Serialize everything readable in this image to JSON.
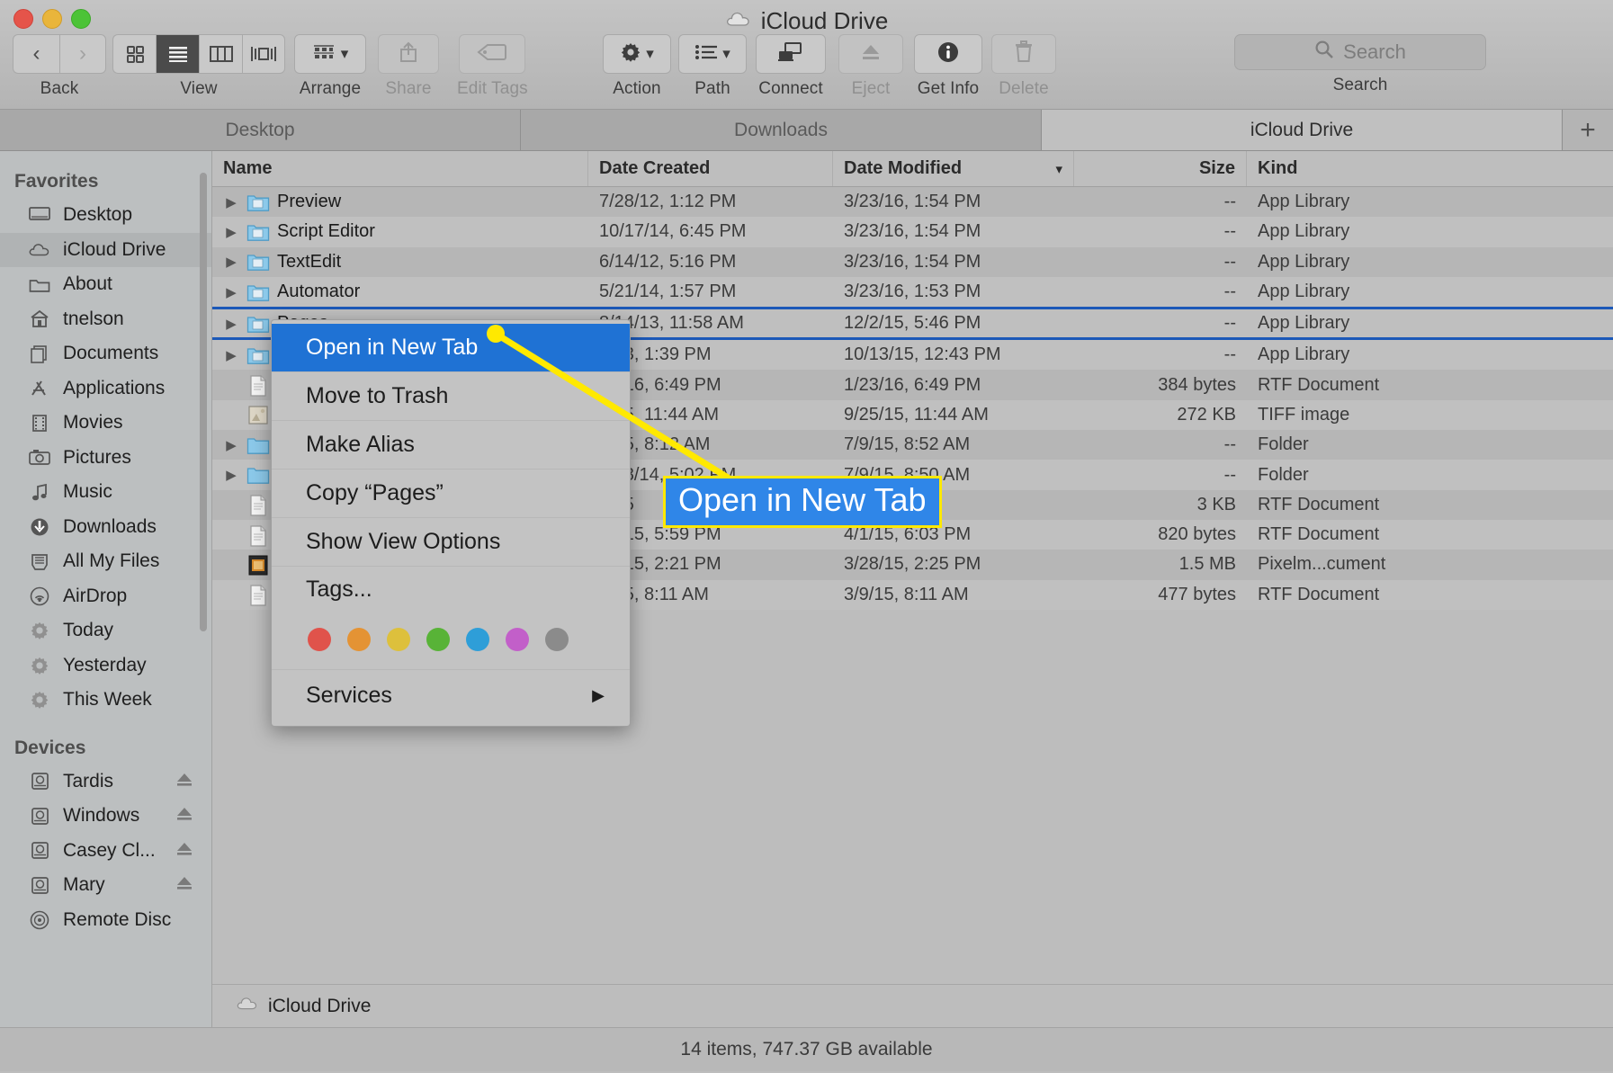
{
  "window": {
    "title": "iCloud Drive",
    "title_icon": "cloud-icon",
    "traffic_lights": [
      "close",
      "minimize",
      "zoom"
    ]
  },
  "toolbar": {
    "back_label": "Back",
    "back_icon": "chevron-left-icon",
    "forward_icon": "chevron-right-icon",
    "view_label": "View",
    "view_modes": [
      "icon-view-icon",
      "list-view-icon",
      "column-view-icon",
      "cover-flow-icon"
    ],
    "view_active_index": 1,
    "arrange_label": "Arrange",
    "arrange_icon": "grid-arrange-icon",
    "share_label": "Share",
    "share_icon": "share-icon",
    "edit_tags_label": "Edit Tags",
    "edit_tags_icon": "tag-icon",
    "action_label": "Action",
    "action_icon": "gear-icon",
    "path_label": "Path",
    "path_icon": "list-path-icon",
    "connect_label": "Connect",
    "connect_icon": "connect-server-icon",
    "eject_label": "Eject",
    "eject_icon": "eject-icon",
    "get_info_label": "Get Info",
    "get_info_icon": "info-icon",
    "delete_label": "Delete",
    "delete_icon": "trash-icon",
    "search_label": "Search",
    "search_placeholder": "Search",
    "search_icon": "search-icon",
    "search_value": ""
  },
  "tabs": {
    "items": [
      {
        "label": "Desktop",
        "active": false
      },
      {
        "label": "Downloads",
        "active": false
      },
      {
        "label": "iCloud Drive",
        "active": true
      }
    ],
    "new_tab_label": "+",
    "new_tab_icon": "plus-icon"
  },
  "sidebar": {
    "sections": [
      {
        "title": "Favorites",
        "items": [
          {
            "label": "Desktop",
            "icon": "desktop-icon",
            "selected": false,
            "eject": false
          },
          {
            "label": "iCloud Drive",
            "icon": "cloud-icon",
            "selected": true,
            "eject": false
          },
          {
            "label": "About",
            "icon": "folder-icon",
            "selected": false,
            "eject": false
          },
          {
            "label": "tnelson",
            "icon": "home-icon",
            "selected": false,
            "eject": false
          },
          {
            "label": "Documents",
            "icon": "documents-icon",
            "selected": false,
            "eject": false
          },
          {
            "label": "Applications",
            "icon": "applications-icon",
            "selected": false,
            "eject": false
          },
          {
            "label": "Movies",
            "icon": "film-icon",
            "selected": false,
            "eject": false
          },
          {
            "label": "Pictures",
            "icon": "camera-icon",
            "selected": false,
            "eject": false
          },
          {
            "label": "Music",
            "icon": "music-note-icon",
            "selected": false,
            "eject": false
          },
          {
            "label": "Downloads",
            "icon": "download-icon",
            "selected": false,
            "eject": false
          },
          {
            "label": "All My Files",
            "icon": "all-my-files-icon",
            "selected": false,
            "eject": false
          },
          {
            "label": "AirDrop",
            "icon": "airdrop-icon",
            "selected": false,
            "eject": false
          },
          {
            "label": "Today",
            "icon": "gear-icon",
            "selected": false,
            "eject": false
          },
          {
            "label": "Yesterday",
            "icon": "gear-icon",
            "selected": false,
            "eject": false
          },
          {
            "label": "This Week",
            "icon": "gear-icon",
            "selected": false,
            "eject": false
          }
        ]
      },
      {
        "title": "Devices",
        "items": [
          {
            "label": "Tardis",
            "icon": "hard-drive-icon",
            "selected": false,
            "eject": true
          },
          {
            "label": "Windows",
            "icon": "hard-drive-icon",
            "selected": false,
            "eject": true
          },
          {
            "label": "Casey Cl...",
            "icon": "hard-drive-icon",
            "selected": false,
            "eject": true
          },
          {
            "label": "Mary",
            "icon": "hard-drive-icon",
            "selected": false,
            "eject": true
          },
          {
            "label": "Remote Disc",
            "icon": "optical-disc-icon",
            "selected": false,
            "eject": false
          }
        ]
      }
    ]
  },
  "file_list": {
    "columns": [
      "Name",
      "Date Created",
      "Date Modified",
      "Size",
      "Kind"
    ],
    "sorted_column": "Date Modified",
    "sort_icon": "chevron-down-icon",
    "rows": [
      {
        "name": "Preview",
        "created": "7/28/12, 1:12 PM",
        "modified": "3/23/16, 1:54 PM",
        "size": "--",
        "kind": "App Library",
        "icon": "app-folder-icon",
        "disclosure": true,
        "selected": false
      },
      {
        "name": "Script Editor",
        "created": "10/17/14, 6:45 PM",
        "modified": "3/23/16, 1:54 PM",
        "size": "--",
        "kind": "App Library",
        "icon": "app-folder-icon",
        "disclosure": true,
        "selected": false
      },
      {
        "name": "TextEdit",
        "created": "6/14/12, 5:16 PM",
        "modified": "3/23/16, 1:54 PM",
        "size": "--",
        "kind": "App Library",
        "icon": "app-folder-icon",
        "disclosure": true,
        "selected": false
      },
      {
        "name": "Automator",
        "created": "5/21/14, 1:57 PM",
        "modified": "3/23/16, 1:53 PM",
        "size": "--",
        "kind": "App Library",
        "icon": "app-folder-icon",
        "disclosure": true,
        "selected": false
      },
      {
        "name": "Pages",
        "created": "8/14/13, 11:58 AM",
        "modified": "12/2/15, 5:46 PM",
        "size": "--",
        "kind": "App Library",
        "icon": "app-folder-icon",
        "disclosure": true,
        "selected": true
      },
      {
        "name": "",
        "created": "9/13, 1:39 PM",
        "modified": "10/13/15, 12:43 PM",
        "size": "--",
        "kind": "App Library",
        "icon": "app-folder-icon",
        "disclosure": true,
        "selected": false
      },
      {
        "name": "",
        "created": "23/16, 6:49 PM",
        "modified": "1/23/16, 6:49 PM",
        "size": "384 bytes",
        "kind": "RTF Document",
        "icon": "document-icon",
        "disclosure": false,
        "selected": false
      },
      {
        "name": "",
        "created": "5/15, 11:44 AM",
        "modified": "9/25/15, 11:44 AM",
        "size": "272 KB",
        "kind": "TIFF image",
        "icon": "image-icon",
        "disclosure": false,
        "selected": false
      },
      {
        "name": "",
        "created": "9/15, 8:12 AM",
        "modified": "7/9/15, 8:52 AM",
        "size": "--",
        "kind": "Folder",
        "icon": "folder-icon",
        "disclosure": true,
        "selected": false
      },
      {
        "name": "",
        "created": "7/18/14, 5:02 PM",
        "modified": "7/9/15, 8:50 AM",
        "size": "--",
        "kind": "Folder",
        "icon": "folder-icon",
        "disclosure": true,
        "selected": false
      },
      {
        "name": "",
        "created": "9/15",
        "modified": "05 PM",
        "size": "3 KB",
        "kind": "RTF Document",
        "icon": "document-icon",
        "disclosure": false,
        "selected": false
      },
      {
        "name": "",
        "created": "27/15, 5:59 PM",
        "modified": "4/1/15, 6:03 PM",
        "size": "820 bytes",
        "kind": "RTF Document",
        "icon": "document-icon",
        "disclosure": false,
        "selected": false
      },
      {
        "name": "",
        "created": "28/15, 2:21 PM",
        "modified": "3/28/15, 2:25 PM",
        "size": "1.5 MB",
        "kind": "Pixelm...cument",
        "icon": "pixelmator-icon",
        "disclosure": false,
        "selected": false
      },
      {
        "name": "",
        "created": "9/15, 8:11 AM",
        "modified": "3/9/15, 8:11 AM",
        "size": "477 bytes",
        "kind": "RTF Document",
        "icon": "document-icon",
        "disclosure": false,
        "selected": false
      }
    ]
  },
  "context_menu": {
    "items": [
      {
        "label": "Open in New Tab",
        "highlighted": true,
        "submenu": false
      },
      {
        "label": "Move to Trash",
        "highlighted": false,
        "submenu": false
      },
      {
        "label": "Make Alias",
        "highlighted": false,
        "submenu": false
      },
      {
        "label": "Copy “Pages”",
        "highlighted": false,
        "submenu": false
      },
      {
        "label": "Show View Options",
        "highlighted": false,
        "submenu": false
      },
      {
        "label": "Tags...",
        "highlighted": false,
        "submenu": false
      }
    ],
    "tag_colors": [
      "#e0534b",
      "#e49334",
      "#ddc03c",
      "#58b337",
      "#2e9ed8",
      "#c25fc9",
      "#8b8b8b"
    ],
    "services": {
      "label": "Services",
      "submenu_icon": "triangle-right-icon"
    }
  },
  "callout": {
    "text": "Open in New Tab",
    "box_color": "#2f86e8",
    "border_color": "#ffe900",
    "leader_color": "#ffe900"
  },
  "path_bar": {
    "label": "iCloud Drive",
    "icon": "cloud-icon"
  },
  "status_bar": {
    "text": "14 items, 747.37 GB available"
  }
}
